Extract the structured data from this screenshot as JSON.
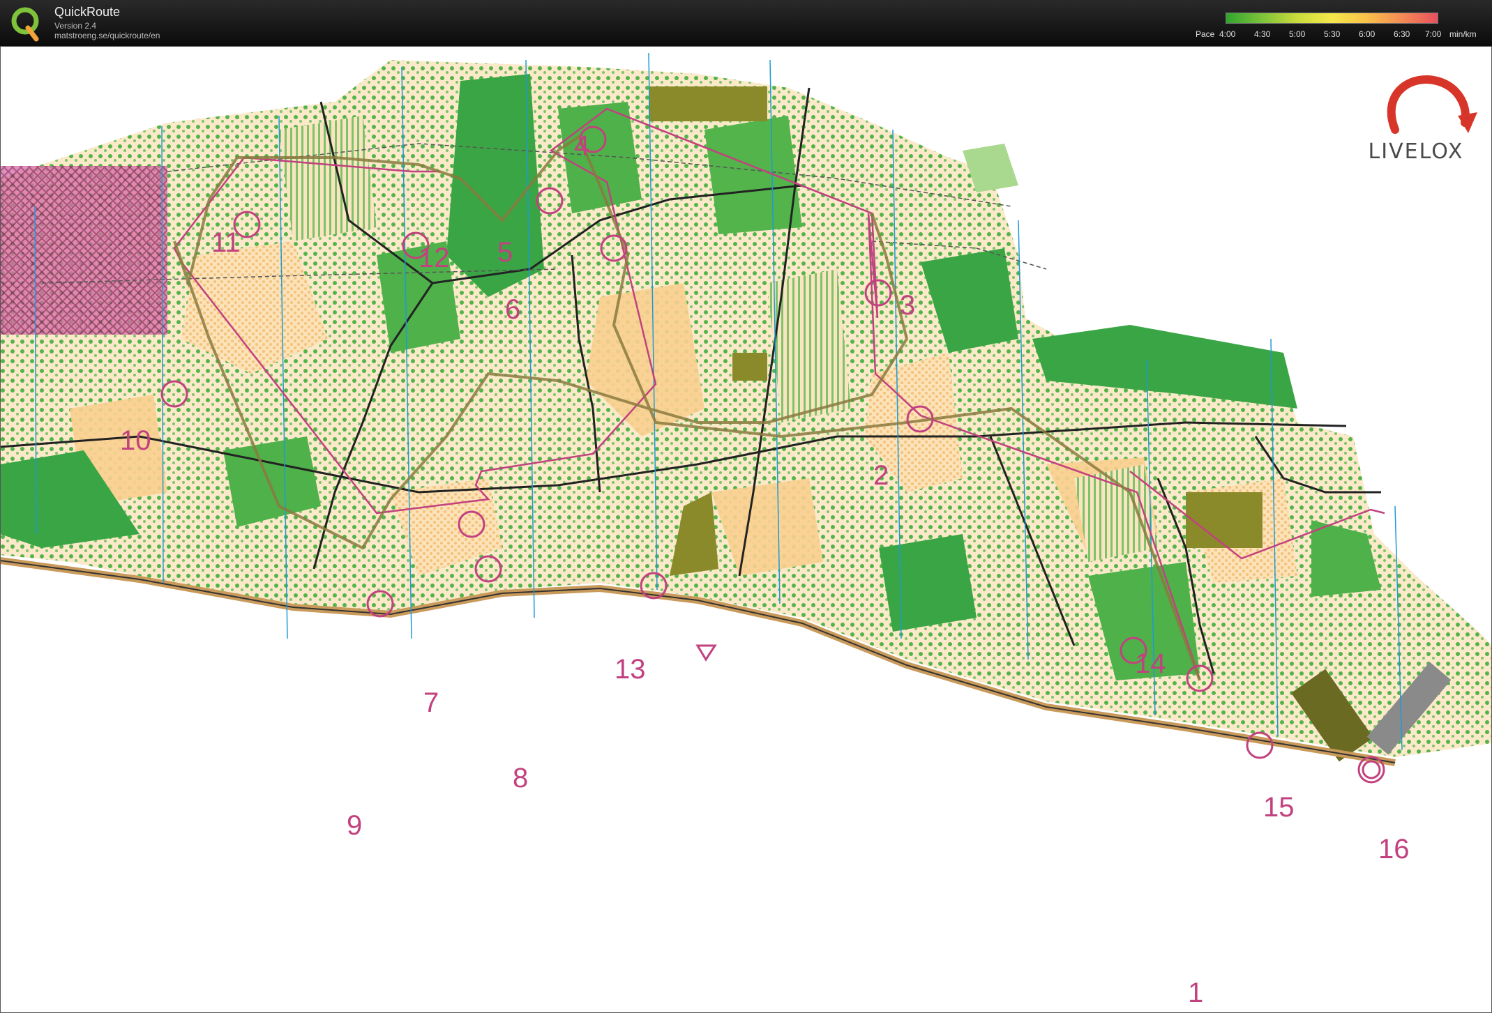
{
  "app": {
    "name": "QuickRoute",
    "version": "Version 2.4",
    "url": "matstroeng.se/quickroute/en"
  },
  "pace_legend": {
    "label": "Pace",
    "ticks": [
      "4:00",
      "4:30",
      "5:00",
      "5:30",
      "6:00",
      "6:30",
      "7:00"
    ],
    "unit": "min/km",
    "colors": [
      "#2fa52f",
      "#7cc23a",
      "#c9dc3b",
      "#f5e84a",
      "#f9c04a",
      "#f48a55",
      "#e8505e"
    ]
  },
  "brand": {
    "livelox": "LIVELOX"
  },
  "map": {
    "course_color": "#c2417f",
    "controls": [
      "1",
      "2",
      "3",
      "4",
      "5",
      "6",
      "7",
      "8",
      "9",
      "10",
      "11",
      "12",
      "13",
      "14",
      "15",
      "16"
    ]
  }
}
